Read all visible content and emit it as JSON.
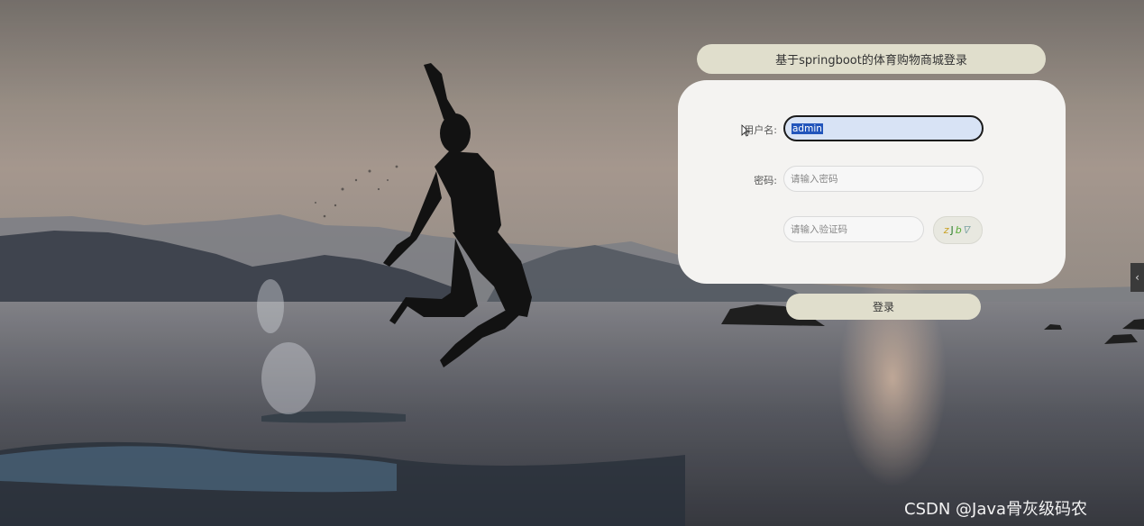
{
  "form": {
    "title": "基于springboot的体育购物商城登录",
    "username_label": "用户名:",
    "username_value": "admin",
    "password_label": "密码:",
    "password_placeholder": "请输入密码",
    "captcha_placeholder": "请输入验证码",
    "captcha_text": [
      "z",
      "J",
      "b",
      "ᐁ"
    ],
    "login_label": "登录"
  },
  "side_tab": {
    "icon": "chevron-left-icon",
    "glyph": "‹"
  },
  "watermark": "CSDN @Java骨灰级码农",
  "colors": {
    "button_bg": "#e0decc",
    "panel_bg": "#f4f3f1",
    "selection": "#2255bb"
  }
}
